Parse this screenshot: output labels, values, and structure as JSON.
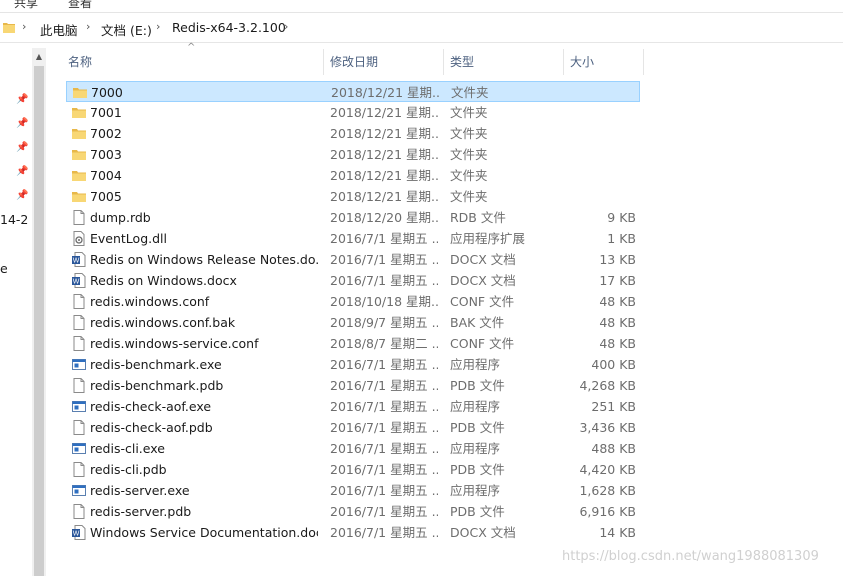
{
  "ribbon": {
    "item1": "共享",
    "item2": "查看"
  },
  "breadcrumb": [
    "此电脑",
    "文档 (E:)",
    "Redis-x64-3.2.100"
  ],
  "nav": {
    "text1": "14-2",
    "text2": "e"
  },
  "columns": {
    "name": "名称",
    "date": "修改日期",
    "type": "类型",
    "size": "大小"
  },
  "files": [
    {
      "name": "7000",
      "date": "2018/12/21 星期...",
      "type": "文件夹",
      "size": "",
      "icon": "folder-icon"
    },
    {
      "name": "7001",
      "date": "2018/12/21 星期...",
      "type": "文件夹",
      "size": "",
      "icon": "folder-icon"
    },
    {
      "name": "7002",
      "date": "2018/12/21 星期...",
      "type": "文件夹",
      "size": "",
      "icon": "folder-icon"
    },
    {
      "name": "7003",
      "date": "2018/12/21 星期...",
      "type": "文件夹",
      "size": "",
      "icon": "folder-icon"
    },
    {
      "name": "7004",
      "date": "2018/12/21 星期...",
      "type": "文件夹",
      "size": "",
      "icon": "folder-icon"
    },
    {
      "name": "7005",
      "date": "2018/12/21 星期...",
      "type": "文件夹",
      "size": "",
      "icon": "folder-icon"
    },
    {
      "name": "dump.rdb",
      "date": "2018/12/20 星期...",
      "type": "RDB 文件",
      "size": "9 KB",
      "icon": "file-icon"
    },
    {
      "name": "EventLog.dll",
      "date": "2016/7/1 星期五 ...",
      "type": "应用程序扩展",
      "size": "1 KB",
      "icon": "dll-icon"
    },
    {
      "name": "Redis on Windows Release Notes.do...",
      "date": "2016/7/1 星期五 ...",
      "type": "DOCX 文档",
      "size": "13 KB",
      "icon": "docx-icon"
    },
    {
      "name": "Redis on Windows.docx",
      "date": "2016/7/1 星期五 ...",
      "type": "DOCX 文档",
      "size": "17 KB",
      "icon": "docx-icon"
    },
    {
      "name": "redis.windows.conf",
      "date": "2018/10/18 星期...",
      "type": "CONF 文件",
      "size": "48 KB",
      "icon": "file-icon"
    },
    {
      "name": "redis.windows.conf.bak",
      "date": "2018/9/7 星期五 ...",
      "type": "BAK 文件",
      "size": "48 KB",
      "icon": "file-icon"
    },
    {
      "name": "redis.windows-service.conf",
      "date": "2018/8/7 星期二 ...",
      "type": "CONF 文件",
      "size": "48 KB",
      "icon": "file-icon"
    },
    {
      "name": "redis-benchmark.exe",
      "date": "2016/7/1 星期五 ...",
      "type": "应用程序",
      "size": "400 KB",
      "icon": "exe-icon"
    },
    {
      "name": "redis-benchmark.pdb",
      "date": "2016/7/1 星期五 ...",
      "type": "PDB 文件",
      "size": "4,268 KB",
      "icon": "file-icon"
    },
    {
      "name": "redis-check-aof.exe",
      "date": "2016/7/1 星期五 ...",
      "type": "应用程序",
      "size": "251 KB",
      "icon": "exe-icon"
    },
    {
      "name": "redis-check-aof.pdb",
      "date": "2016/7/1 星期五 ...",
      "type": "PDB 文件",
      "size": "3,436 KB",
      "icon": "file-icon"
    },
    {
      "name": "redis-cli.exe",
      "date": "2016/7/1 星期五 ...",
      "type": "应用程序",
      "size": "488 KB",
      "icon": "exe-icon"
    },
    {
      "name": "redis-cli.pdb",
      "date": "2016/7/1 星期五 ...",
      "type": "PDB 文件",
      "size": "4,420 KB",
      "icon": "file-icon"
    },
    {
      "name": "redis-server.exe",
      "date": "2016/7/1 星期五 ...",
      "type": "应用程序",
      "size": "1,628 KB",
      "icon": "exe-icon"
    },
    {
      "name": "redis-server.pdb",
      "date": "2016/7/1 星期五 ...",
      "type": "PDB 文件",
      "size": "6,916 KB",
      "icon": "file-icon"
    },
    {
      "name": "Windows Service Documentation.docx",
      "date": "2016/7/1 星期五 ...",
      "type": "DOCX 文档",
      "size": "14 KB",
      "icon": "docx-icon"
    }
  ],
  "watermark": "https://blog.csdn.net/wang1988081309",
  "colors": {
    "selection": "#cce8ff",
    "folder": "#f8d775",
    "header_text": "#4d6180"
  }
}
